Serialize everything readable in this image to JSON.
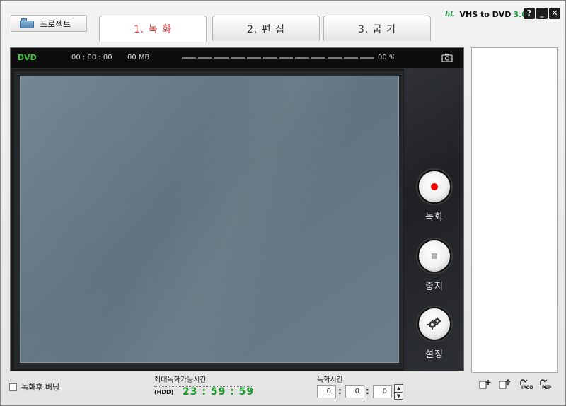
{
  "toolbar": {
    "project_label": "프로젝트"
  },
  "tabs": [
    {
      "label": "1. 녹 화",
      "active": true
    },
    {
      "label": "2. 편 집",
      "active": false
    },
    {
      "label": "3. 굽 기",
      "active": false
    }
  ],
  "brand": {
    "logo": "hL",
    "name": "VHS to DVD",
    "version": "3.0"
  },
  "window_buttons": {
    "help": "?",
    "minimize": "_",
    "close": "✕"
  },
  "status": {
    "media": "DVD",
    "elapsed": "00 : 00 : 00",
    "size": "00 MB",
    "progress_percent": 0,
    "percent_label": "00 %"
  },
  "controls": {
    "record_label": "녹화",
    "stop_label": "중지",
    "settings_label": "설정"
  },
  "list_tools": [
    {
      "icon": "add-file-icon",
      "label": ""
    },
    {
      "icon": "export-file-icon",
      "label": ""
    },
    {
      "icon": "ipod-convert-icon",
      "label": "IPOD"
    },
    {
      "icon": "psp-convert-icon",
      "label": "PSP"
    }
  ],
  "bottom": {
    "burn_after_record_label": "녹화후 버닝",
    "burn_after_record_checked": false,
    "max_record_title": "최대녹화가능시간",
    "hdd_label": "(HDD)",
    "max_record_time": "23 : 59 : 59",
    "record_time_title": "녹화시간",
    "record_hours": "0",
    "record_minutes": "0",
    "record_seconds": "0"
  },
  "colors": {
    "accent_red": "#e23a3a",
    "status_green": "#3fc23f",
    "time_green": "#1e9a2a"
  }
}
